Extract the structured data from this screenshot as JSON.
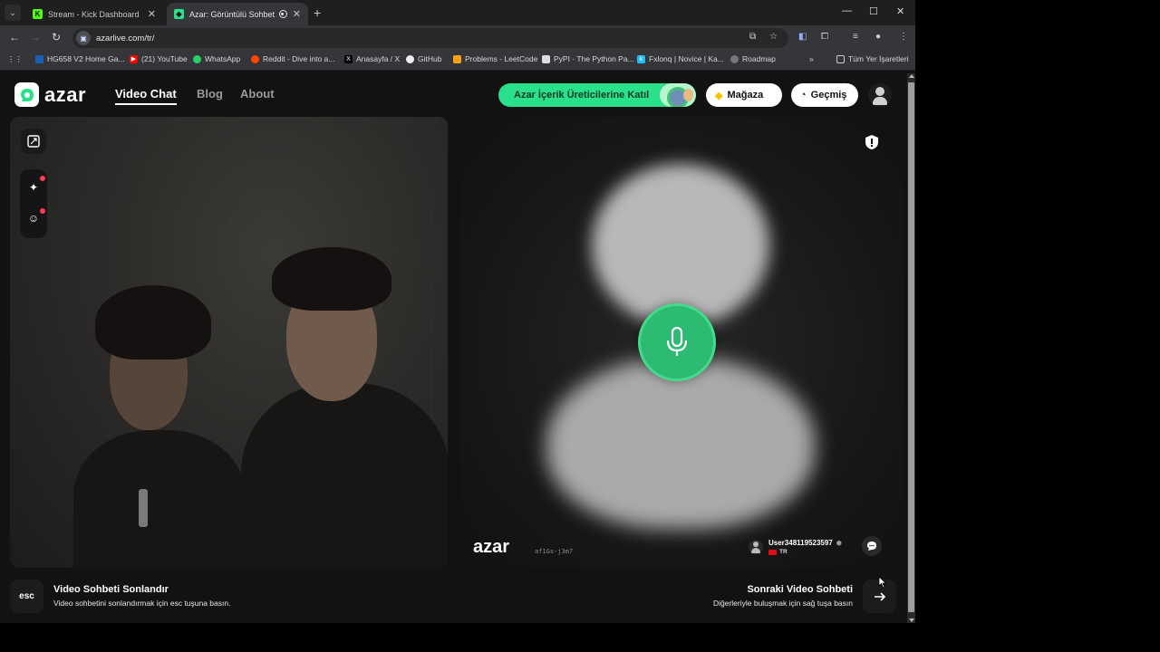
{
  "browser": {
    "tabs": [
      {
        "title": "Stream - Kick Dashboard",
        "favicon": "kick-icon",
        "active": false
      },
      {
        "title": "Azar: Görüntülü Sohbet, Ye",
        "favicon": "azar-icon",
        "active": true
      }
    ],
    "url": "azarlive.com/tr/",
    "bookmarks": [
      {
        "label": "HG658 V2 Home Ga...",
        "icon": "zte-icon"
      },
      {
        "label": "(21) YouTube",
        "icon": "youtube-icon"
      },
      {
        "label": "WhatsApp",
        "icon": "whatsapp-icon"
      },
      {
        "label": "Reddit - Dive into a...",
        "icon": "reddit-icon"
      },
      {
        "label": "Anasayfa / X",
        "icon": "x-icon"
      },
      {
        "label": "GitHub",
        "icon": "github-icon"
      },
      {
        "label": "Problems - LeetCode",
        "icon": "leetcode-icon"
      },
      {
        "label": "PyPI · The Python Pa...",
        "icon": "pypi-icon"
      },
      {
        "label": "Fxlonq | Novice | Ka...",
        "icon": "kaggle-icon"
      },
      {
        "label": "Roadmap",
        "icon": "roadmap-icon"
      }
    ],
    "all_bookmarks": "Tüm Yer İşaretleri"
  },
  "header": {
    "logo_text": "azar",
    "nav": [
      {
        "label": "Video Chat",
        "active": true
      },
      {
        "label": "Blog",
        "active": false
      },
      {
        "label": "About",
        "active": false
      }
    ],
    "creator_button": "Azar İçerik Üreticilerine Katıl",
    "shop_button": "Mağaza",
    "history_button": "Geçmiş"
  },
  "remote": {
    "watermark": "azar",
    "watermark_id": "af1Gs-j3m7",
    "username": "User348119523597",
    "country": "TR"
  },
  "footer": {
    "esc_key": "esc",
    "end_title": "Video Sohbeti Sonlandır",
    "end_sub": "Video sohbetini sonlandırmak için esc tuşuna basın.",
    "next_title": "Sonraki Video Sohbeti",
    "next_sub": "Diğerleriyle buluşmak için sağ tuşa basın"
  },
  "colors": {
    "accent_green": "#2be08a",
    "mic_green": "#2dbb74",
    "notification_red": "#ff3b57"
  }
}
